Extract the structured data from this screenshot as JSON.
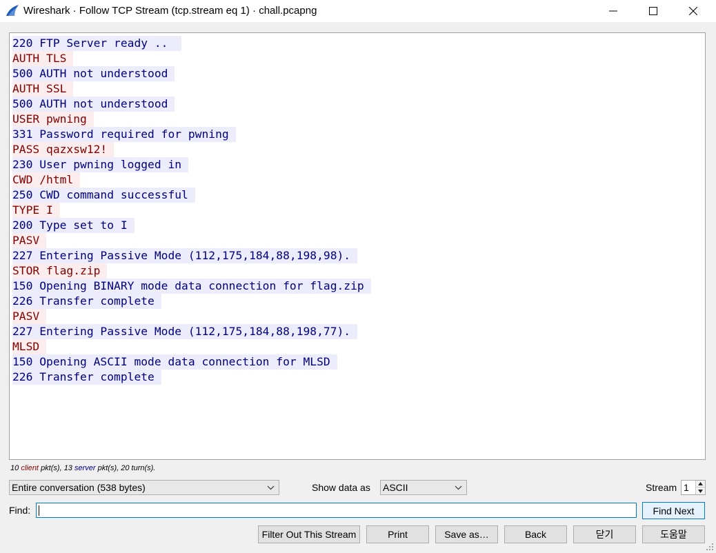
{
  "window": {
    "title": "Wireshark · Follow TCP Stream (tcp.stream eq 1) · chall.pcapng",
    "colors": {
      "client_text": "#800000",
      "client_bg": "#fbeded",
      "server_text": "#00007f",
      "server_bg": "#ececfb",
      "app_icon": "#1e5bb8"
    }
  },
  "stream": {
    "lines": [
      {
        "role": "server",
        "text": "220 FTP Server ready .. "
      },
      {
        "role": "client",
        "text": "AUTH TLS"
      },
      {
        "role": "server",
        "text": "500 AUTH not understood"
      },
      {
        "role": "client",
        "text": "AUTH SSL"
      },
      {
        "role": "server",
        "text": "500 AUTH not understood"
      },
      {
        "role": "client",
        "text": "USER pwning"
      },
      {
        "role": "server",
        "text": "331 Password required for pwning"
      },
      {
        "role": "client",
        "text": "PASS qazxsw12!"
      },
      {
        "role": "server",
        "text": "230 User pwning logged in"
      },
      {
        "role": "client",
        "text": "CWD /html"
      },
      {
        "role": "server",
        "text": "250 CWD command successful"
      },
      {
        "role": "client",
        "text": "TYPE I"
      },
      {
        "role": "server",
        "text": "200 Type set to I"
      },
      {
        "role": "client",
        "text": "PASV"
      },
      {
        "role": "server",
        "text": "227 Entering Passive Mode (112,175,184,88,198,98)."
      },
      {
        "role": "client",
        "text": "STOR flag.zip"
      },
      {
        "role": "server",
        "text": "150 Opening BINARY mode data connection for flag.zip"
      },
      {
        "role": "server",
        "text": "226 Transfer complete"
      },
      {
        "role": "client",
        "text": "PASV"
      },
      {
        "role": "server",
        "text": "227 Entering Passive Mode (112,175,184,88,198,77)."
      },
      {
        "role": "client",
        "text": "MLSD"
      },
      {
        "role": "server",
        "text": "150 Opening ASCII mode data connection for MLSD"
      },
      {
        "role": "server",
        "text": "226 Transfer complete"
      }
    ]
  },
  "summary": {
    "client_count": "10",
    "client_word": "client",
    "client_suffix": "pkt(s),",
    "server_count": "13",
    "server_word": "server",
    "server_suffix": "pkt(s), 20 turn(s)."
  },
  "controls": {
    "conversation_value": "Entire conversation (538 bytes)",
    "show_data_label": "Show data as",
    "show_data_value": "ASCII",
    "stream_label": "Stream",
    "stream_value": "1",
    "find_label": "Find:",
    "find_value": "",
    "find_next_label": "Find Next"
  },
  "buttons": {
    "filter_out": "Filter Out This Stream",
    "print": "Print",
    "save_as": "Save as…",
    "back": "Back",
    "close": "닫기",
    "help": "도움말"
  },
  "icons": {
    "app": "wireshark-fin-icon",
    "minimize": "minimize-icon",
    "maximize": "maximize-icon",
    "close": "close-icon",
    "dropdown": "chevron-down-icon",
    "spin_up": "spin-up-icon",
    "spin_down": "spin-down-icon",
    "resize": "resize-grip-icon"
  }
}
